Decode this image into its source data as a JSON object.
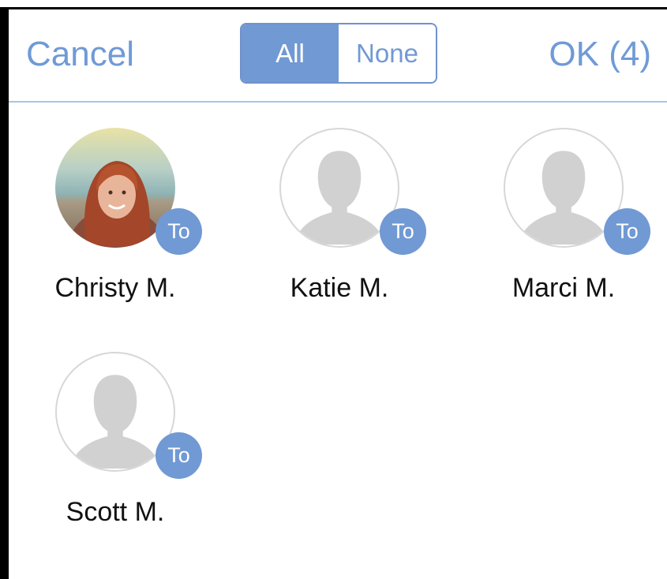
{
  "header": {
    "cancel_label": "Cancel",
    "ok_label": "OK (4)",
    "segment": {
      "all_label": "All",
      "none_label": "None",
      "selected": "All"
    }
  },
  "contacts": [
    {
      "name": "Christy M.",
      "badge": "To",
      "avatar": "photo"
    },
    {
      "name": "Katie M.",
      "badge": "To",
      "avatar": "person-placeholder-icon"
    },
    {
      "name": "Marci M.",
      "badge": "To",
      "avatar": "person-placeholder-icon"
    },
    {
      "name": "Scott M.",
      "badge": "To",
      "avatar": "person-placeholder-icon"
    }
  ],
  "colors": {
    "accent": "#7199d3",
    "separator": "#a8c6e6",
    "placeholder": "#d1d1d1"
  }
}
